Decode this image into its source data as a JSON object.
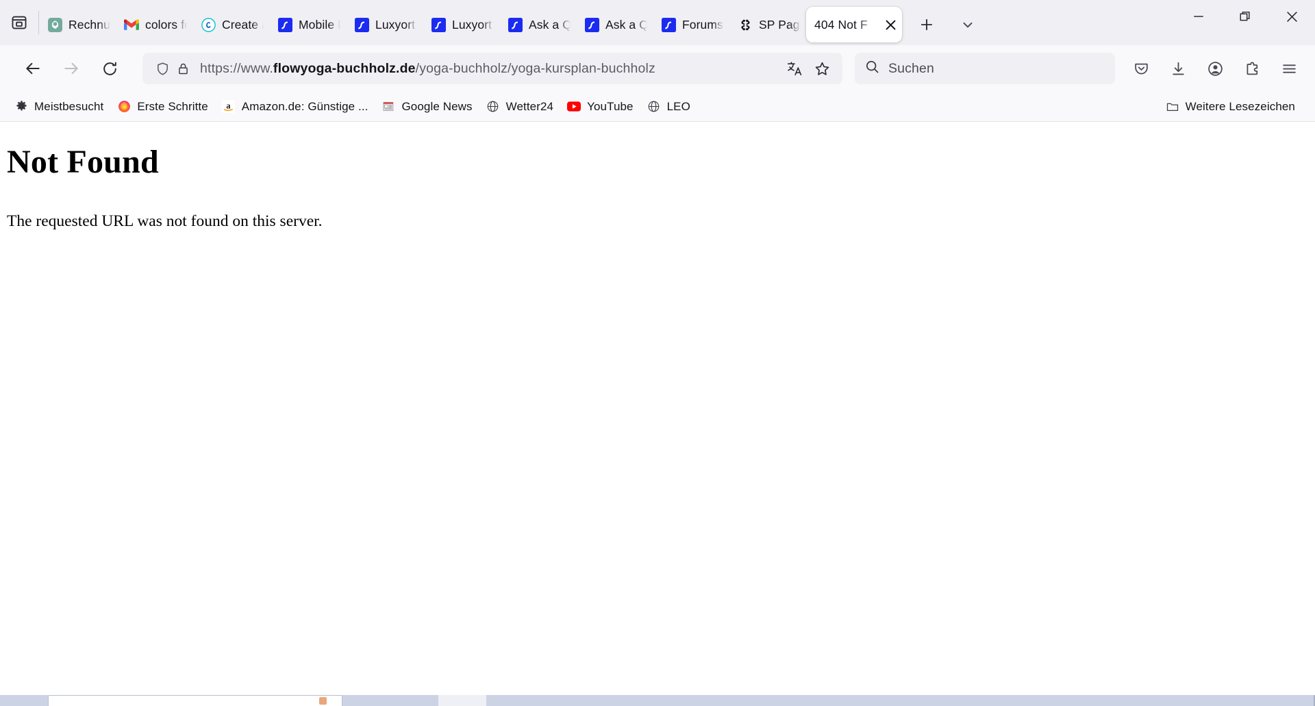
{
  "window": {
    "minimize_label": "Minimieren",
    "restore_label": "Wiederherstellen",
    "close_label": "Schließen"
  },
  "tabstrip": {
    "firefox_view_label": "Firefox View",
    "new_tab_label": "Neuer Tab",
    "list_all_tabs_label": "Alle Tabs anzeigen",
    "tabs": [
      {
        "title": "Rechnun",
        "favicon": "chatgpt-icon",
        "active": false
      },
      {
        "title": "colors fo",
        "favicon": "gmail-icon",
        "active": false
      },
      {
        "title": "Create a",
        "favicon": "canva-icon",
        "active": false
      },
      {
        "title": "Mobile P",
        "favicon": "stackoverflow-icon",
        "active": false
      },
      {
        "title": "Luxyort P",
        "favicon": "stackoverflow-icon",
        "active": false
      },
      {
        "title": "Luxyort P",
        "favicon": "stackoverflow-icon",
        "active": false
      },
      {
        "title": "Ask a Qu",
        "favicon": "stackoverflow-icon",
        "active": false
      },
      {
        "title": "Ask a Qu",
        "favicon": "stackoverflow-icon",
        "active": false
      },
      {
        "title": "Forums |",
        "favicon": "stackoverflow-icon",
        "active": false
      },
      {
        "title": "SP Page",
        "favicon": "joomla-icon",
        "active": false
      },
      {
        "title": "404 Not F",
        "favicon": "none",
        "active": true
      }
    ]
  },
  "navbar": {
    "back_label": "Zurück",
    "forward_label": "Vor",
    "reload_label": "Neu laden",
    "url_prefix": "https://www.",
    "url_domain": "flowyoga-buchholz.de",
    "url_path": "/yoga-buchholz/yoga-kursplan-buchholz",
    "url_full": "https://www.flowyoga-buchholz.de/yoga-buchholz/yoga-kursplan-buchholz",
    "shield_label": "Schutzmaßnahmen",
    "lock_label": "Verbindungssicherheit",
    "translate_label": "Diese Seite übersetzen",
    "bookmark_label": "Lesezeichen hinzufügen",
    "search_placeholder": "Suchen",
    "pocket_label": "Bei Pocket speichern",
    "downloads_label": "Downloads",
    "account_label": "Konto",
    "extensions_label": "Erweiterungen",
    "menu_label": "Anwendungsmenü öffnen"
  },
  "bookmarks": [
    {
      "label": "Meistbesucht",
      "icon": "gear-icon"
    },
    {
      "label": "Erste Schritte",
      "icon": "firefox-icon"
    },
    {
      "label": "Amazon.de: Günstige ...",
      "icon": "amazon-icon"
    },
    {
      "label": "Google News",
      "icon": "news-icon"
    },
    {
      "label": "Wetter24",
      "icon": "globe-icon"
    },
    {
      "label": "YouTube",
      "icon": "youtube-icon"
    },
    {
      "label": "LEO",
      "icon": "globe-icon"
    }
  ],
  "bookmarks_more": {
    "label": "Weitere Lesezeichen",
    "icon": "folder-icon"
  },
  "page": {
    "heading": "Not Found",
    "body": "The requested URL was not found on this server."
  },
  "colors": {
    "tabstrip_bg": "#f0eff4",
    "toolbar_bg": "#f9f9fb",
    "urlbar_bg": "#f0f0f4",
    "text": "#15141a",
    "muted": "#5b5b66",
    "stackoverflow_blue": "#1b2cf0",
    "youtube_red": "#ff0000",
    "taskbar_bg": "#ccd3e4"
  }
}
